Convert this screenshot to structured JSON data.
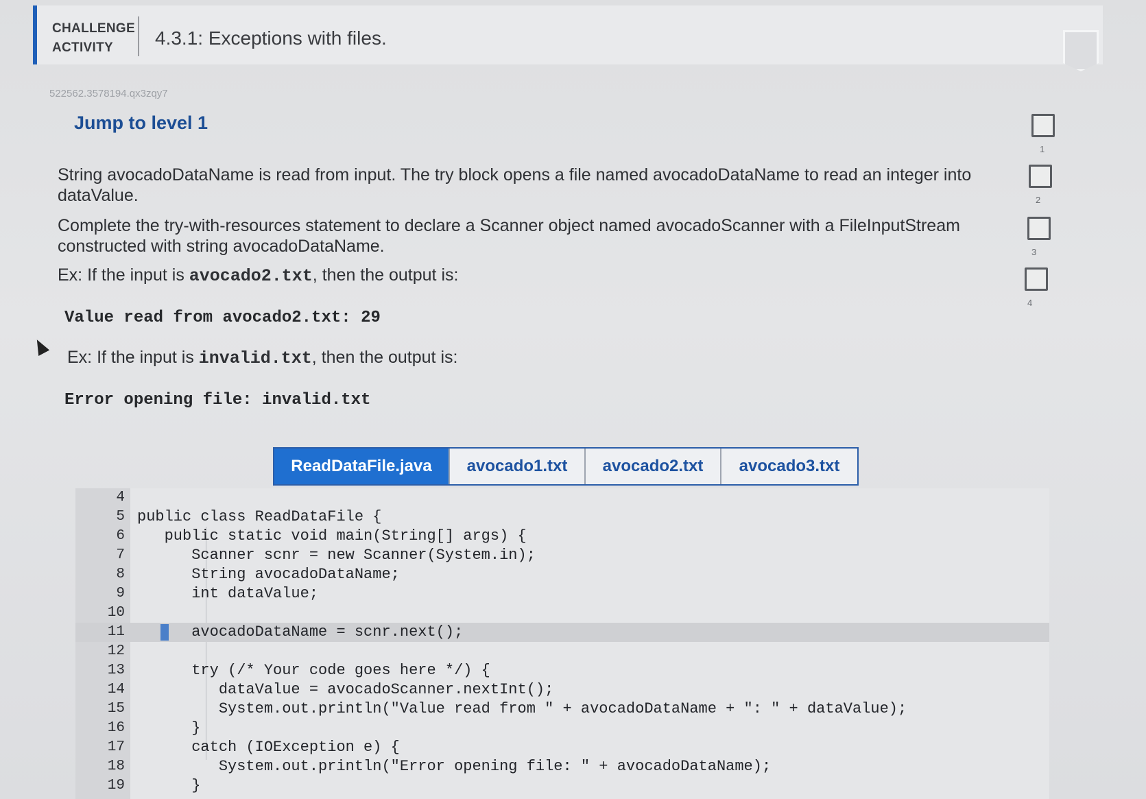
{
  "header": {
    "label_line1": "CHALLENGE",
    "label_line2": "ACTIVITY",
    "title": "4.3.1: Exceptions with files."
  },
  "activity_code": "522562.3578194.qx3zqy7",
  "jump_label": "Jump to level 1",
  "instructions": {
    "para1": "String avocadoDataName is read from input. The try block opens a file named avocadoDataName to read an integer into dataValue.",
    "para2": "Complete the try-with-resources statement to declare a Scanner object named avocadoScanner with a FileInputStream constructed with string avocadoDataName.",
    "ex1_prefix": "Ex: If the input is ",
    "ex1_code": "avocado2.txt",
    "ex1_suffix": ", then the output is:",
    "ex1_output": "Value read from avocado2.txt: 29",
    "ex2_prefix": "Ex: If the input is ",
    "ex2_code": "invalid.txt",
    "ex2_suffix": ", then the output is:",
    "ex2_output": "Error opening file: invalid.txt"
  },
  "levels": [
    "1",
    "2",
    "3",
    "4"
  ],
  "tabs": [
    {
      "label": "ReadDataFile.java",
      "active": true
    },
    {
      "label": "avocado1.txt",
      "active": false
    },
    {
      "label": "avocado2.txt",
      "active": false
    },
    {
      "label": "avocado3.txt",
      "active": false
    }
  ],
  "code_lines": [
    {
      "num": "4",
      "text": ""
    },
    {
      "num": "5",
      "text": "public class ReadDataFile {"
    },
    {
      "num": "6",
      "text": "   public static void main(String[] args) {"
    },
    {
      "num": "7",
      "text": "      Scanner scnr = new Scanner(System.in);"
    },
    {
      "num": "8",
      "text": "      String avocadoDataName;"
    },
    {
      "num": "9",
      "text": "      int dataValue;"
    },
    {
      "num": "10",
      "text": ""
    },
    {
      "num": "11",
      "text": "      avocadoDataName = scnr.next();"
    },
    {
      "num": "12",
      "text": ""
    },
    {
      "num": "13",
      "text": "      try (/* Your code goes here */) {"
    },
    {
      "num": "14",
      "text": "         dataValue = avocadoScanner.nextInt();"
    },
    {
      "num": "15",
      "text": "         System.out.println(\"Value read from \" + avocadoDataName + \": \" + dataValue);"
    },
    {
      "num": "16",
      "text": "      }"
    },
    {
      "num": "17",
      "text": "      catch (IOException e) {"
    },
    {
      "num": "18",
      "text": "         System.out.println(\"Error opening file: \" + avocadoDataName);"
    },
    {
      "num": "19",
      "text": "      }"
    }
  ],
  "colors": {
    "accent": "#1f5fb8",
    "tab_active": "#1f6fd0",
    "jump_text": "#1c4e95"
  }
}
